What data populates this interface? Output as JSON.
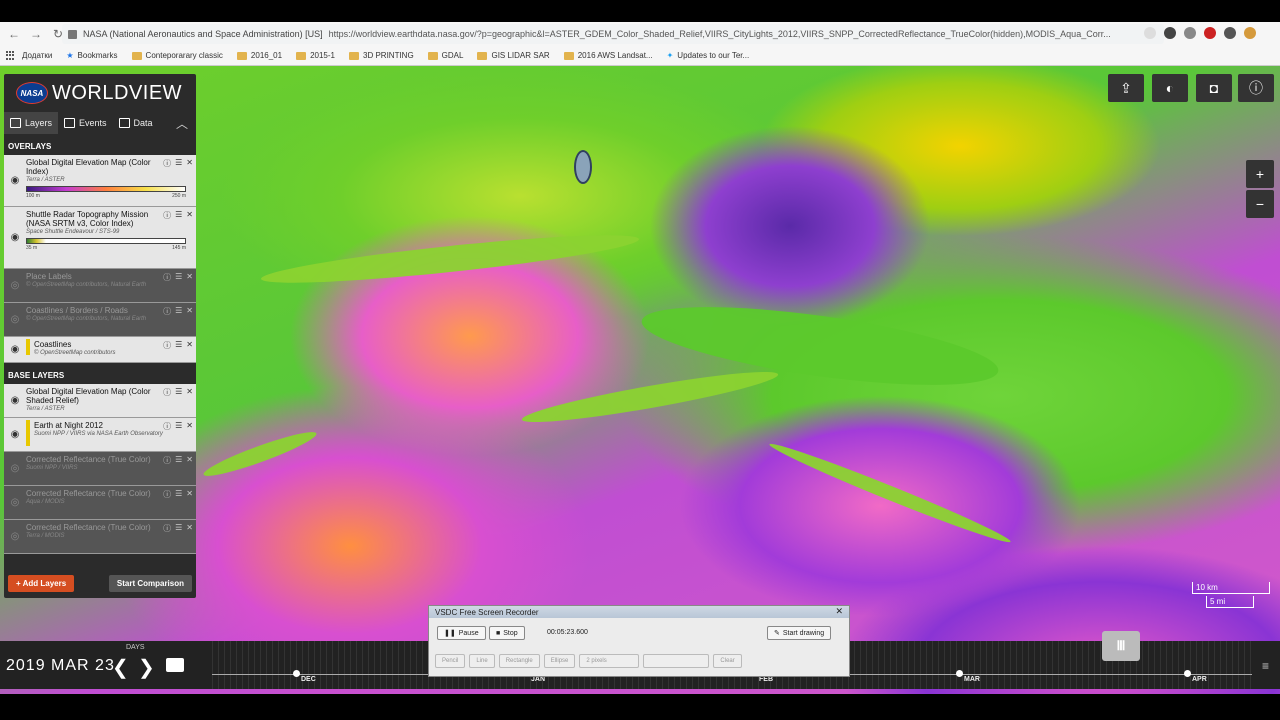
{
  "browser": {
    "site_name": "NASA (National Aeronautics and Space Administration) [US]",
    "url": "https://worldview.earthdata.nasa.gov/?p=geographic&l=ASTER_GDEM_Color_Shaded_Relief,VIIRS_CityLights_2012,VIIRS_SNPP_CorrectedReflectance_TrueColor(hidden),MODIS_Aqua_Corr...",
    "bookmarks": [
      "Додатки",
      "Bookmarks",
      "Conteporarary classic",
      "2016_01",
      "2015-1",
      "3D PRINTING",
      "GDAL",
      "GIS LIDAR SAR",
      "2016 AWS Landsat...",
      "Updates to our Ter..."
    ]
  },
  "worldview": {
    "logo": "NASA",
    "title": "WORLDVIEW",
    "tabs": [
      "Layers",
      "Events",
      "Data"
    ],
    "overlays_title": "OVERLAYS",
    "base_title": "BASE LAYERS",
    "overlays": [
      {
        "name": "Global Digital Elevation Map (Color Index)",
        "sub": "Terra / ASTER",
        "min": "100 m",
        "max": "250 m"
      },
      {
        "name": "Shuttle Radar Topography Mission (NASA SRTM v3, Color Index)",
        "sub": "Space Shuttle Endeavour / STS-99",
        "min": "35 m",
        "max": "145 m"
      },
      {
        "name": "Place Labels",
        "sub": "© OpenStreetMap contributors, Natural Earth"
      },
      {
        "name": "Coastlines / Borders / Roads",
        "sub": "© OpenStreetMap contributors, Natural Earth"
      },
      {
        "name": "Coastlines",
        "sub": "© OpenStreetMap contributors"
      }
    ],
    "base_layers": [
      {
        "name": "Global Digital Elevation Map (Color Shaded Relief)",
        "sub": "Terra / ASTER"
      },
      {
        "name": "Earth at Night 2012",
        "sub": "Suomi NPP / VIIRS via NASA Earth Observatory"
      },
      {
        "name": "Corrected Reflectance (True Color)",
        "sub": "Suomi NPP / VIIRS"
      },
      {
        "name": "Corrected Reflectance (True Color)",
        "sub": "Aqua / MODIS"
      },
      {
        "name": "Corrected Reflectance (True Color)",
        "sub": "Terra / MODIS"
      }
    ],
    "add_layers": "+ Add Layers",
    "start_comparison": "Start Comparison"
  },
  "scale": {
    "km": "10 km",
    "mi": "5 mi"
  },
  "timeline": {
    "date": "2019 MAR 23",
    "days_label": "DAYS",
    "months": [
      "DEC",
      "JAN",
      "FEB",
      "MAR",
      "APR"
    ]
  },
  "recorder": {
    "title": "VSDC Free Screen Recorder",
    "pause": "Pause",
    "stop": "Stop",
    "time": "00:05:23.600",
    "start_drawing": "Start drawing",
    "pencil": "Pencil",
    "line": "Line",
    "rectangle": "Rectangle",
    "ellipse": "Ellipse",
    "pixels": "2 pixels",
    "clear": "Clear"
  }
}
